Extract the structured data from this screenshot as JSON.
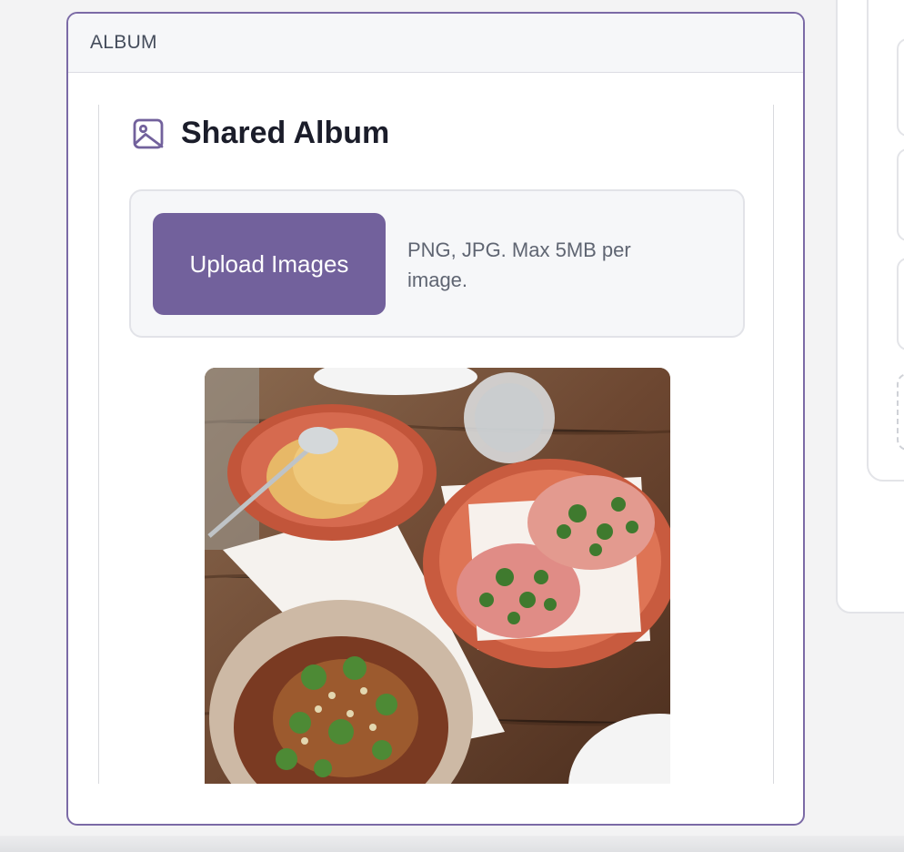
{
  "album_section": {
    "header": "ALBUM",
    "title": "Shared Album",
    "title_icon": "image-icon"
  },
  "upload": {
    "button_label": "Upload Images",
    "hint": "PNG, JPG. Max 5MB per image."
  },
  "colors": {
    "accent": "#72619c",
    "panel_border": "#7b6aa6"
  },
  "photos": [
    {
      "icon": "food-photo"
    }
  ]
}
